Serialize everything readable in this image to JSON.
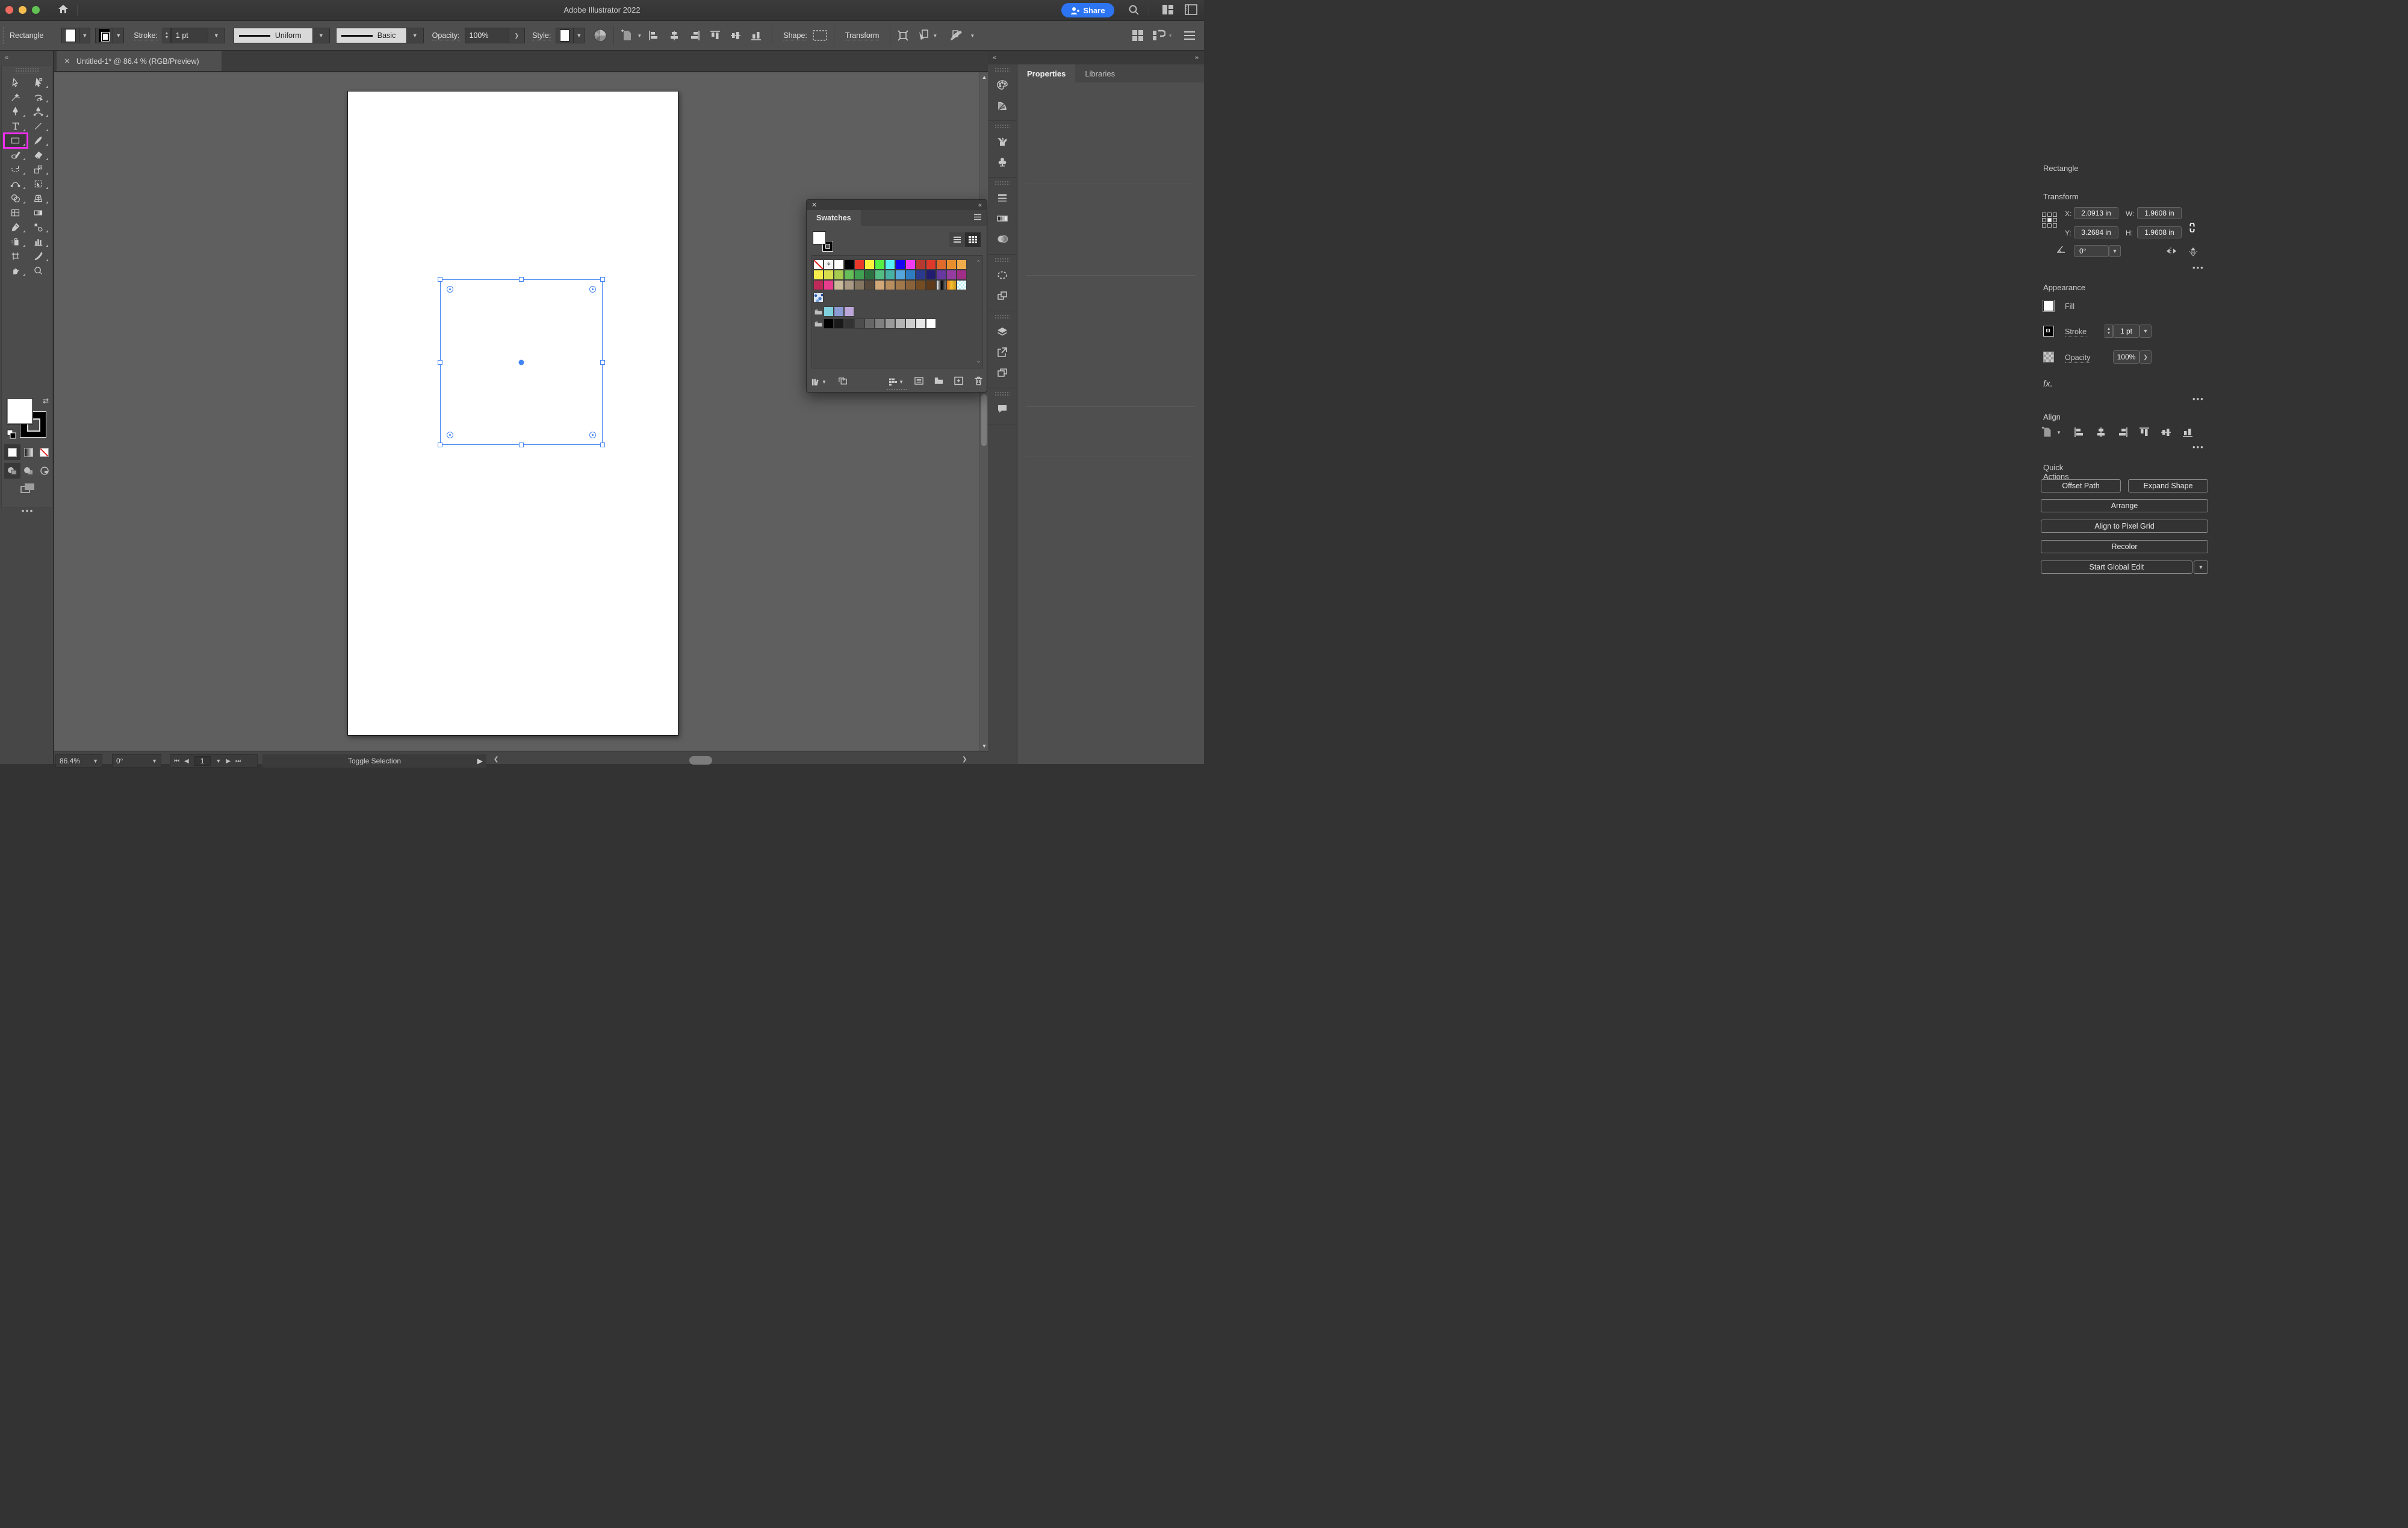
{
  "titlebar": {
    "title": "Adobe Illustrator 2022",
    "share_label": "Share"
  },
  "controlbar": {
    "selection_label": "Rectangle",
    "stroke_label": "Stroke:",
    "stroke_weight": "1 pt",
    "width_profile": "Uniform",
    "brush_definition": "Basic",
    "opacity_label": "Opacity:",
    "opacity_value": "100%",
    "style_label": "Style:",
    "shape_label": "Shape:",
    "transform_label": "Transform"
  },
  "tabbar": {
    "doc_title": "Untitled-1* @ 86.4 % (RGB/Preview)"
  },
  "tools": [
    {
      "name": "selection-tool",
      "flyout": false
    },
    {
      "name": "direct-selection-tool",
      "flyout": true
    },
    {
      "name": "magic-wand-tool",
      "flyout": false
    },
    {
      "name": "lasso-tool",
      "flyout": true
    },
    {
      "name": "pen-tool",
      "flyout": true
    },
    {
      "name": "curvature-tool",
      "flyout": true
    },
    {
      "name": "type-tool",
      "flyout": true
    },
    {
      "name": "line-segment-tool",
      "flyout": true
    },
    {
      "name": "rectangle-tool",
      "flyout": true,
      "active": true
    },
    {
      "name": "paintbrush-tool",
      "flyout": true
    },
    {
      "name": "shaper-tool",
      "flyout": true
    },
    {
      "name": "eraser-tool",
      "flyout": true
    },
    {
      "name": "rotate-tool",
      "flyout": true
    },
    {
      "name": "scale-tool",
      "flyout": true
    },
    {
      "name": "width-tool",
      "flyout": true
    },
    {
      "name": "free-transform-tool",
      "flyout": true
    },
    {
      "name": "shape-builder-tool",
      "flyout": true
    },
    {
      "name": "perspective-grid-tool",
      "flyout": true
    },
    {
      "name": "mesh-tool",
      "flyout": false
    },
    {
      "name": "gradient-tool",
      "flyout": false
    },
    {
      "name": "eyedropper-tool",
      "flyout": true
    },
    {
      "name": "blend-tool",
      "flyout": true
    },
    {
      "name": "symbol-sprayer-tool",
      "flyout": true
    },
    {
      "name": "column-graph-tool",
      "flyout": true
    },
    {
      "name": "artboard-tool",
      "flyout": false
    },
    {
      "name": "slice-tool",
      "flyout": true
    },
    {
      "name": "hand-tool",
      "flyout": true
    },
    {
      "name": "zoom-tool",
      "flyout": false
    }
  ],
  "swatches_panel": {
    "title": "Swatches",
    "rows": [
      [
        "none",
        "registration",
        "#FFFFFF",
        "#000000",
        "#E8392B",
        "#FCF23D",
        "#55EF46",
        "#57EFF5",
        "#1503F2",
        "#EF3BF2",
        "#B53831",
        "#DC392B",
        "#DE6A2C",
        "#E78F2E",
        "#EFAC4C"
      ],
      [
        "#F6EC4B",
        "#D9DF4C",
        "#A6CB4D",
        "#65BE57",
        "#3F9F53",
        "#2C6E40",
        "#53BE83",
        "#47B1A3",
        "#55A6DC",
        "#2E7DC3",
        "#2B3A8F",
        "#221C71",
        "#67389F",
        "#943C9F",
        "#A02E86"
      ],
      [
        "#BE2A58",
        "#E83C8C",
        "#C9B999",
        "#A99884",
        "#83755F",
        "#57493C",
        "#D2A878",
        "#B98E5F",
        "#A0784A",
        "#8A6239",
        "#744C24",
        "#5E3A1A",
        "gradient-bw",
        "gradient-orange",
        "checker"
      ]
    ],
    "pattern_row": [
      "pattern-blue"
    ],
    "color_groups": [
      [
        "#7FD0DC",
        "#8B9BD3",
        "#BCA7D8"
      ],
      [
        "#000000",
        "#1A1A1A",
        "#333333",
        "#4D4D4D",
        "#666666",
        "#808080",
        "#999999",
        "#B3B3B3",
        "#CCCCCC",
        "#E6E6E6",
        "#FFFFFF"
      ]
    ]
  },
  "right_strip_icons": [
    {
      "name": "color-panel-icon",
      "group": 0
    },
    {
      "name": "color-guide-panel-icon",
      "group": 0
    },
    {
      "name": "brushes-panel-icon",
      "group": 1
    },
    {
      "name": "symbols-panel-icon",
      "group": 1
    },
    {
      "name": "stroke-panel-icon",
      "group": 2
    },
    {
      "name": "gradient-panel-icon",
      "group": 2
    },
    {
      "name": "transparency-panel-icon",
      "group": 2
    },
    {
      "name": "appearance-panel-icon",
      "group": 3
    },
    {
      "name": "graphic-styles-panel-icon",
      "group": 3
    },
    {
      "name": "layers-panel-icon",
      "group": 4
    },
    {
      "name": "asset-export-panel-icon",
      "group": 4
    },
    {
      "name": "artboards-panel-icon",
      "group": 4
    },
    {
      "name": "comments-panel-icon",
      "group": 5
    }
  ],
  "properties_panel": {
    "tab_properties": "Properties",
    "tab_libraries": "Libraries",
    "object_type": "Rectangle",
    "transform": {
      "title": "Transform",
      "x_label": "X:",
      "x_value": "2.0913 in",
      "y_label": "Y:",
      "y_value": "3.2684 in",
      "w_label": "W:",
      "w_value": "1.9608 in",
      "h_label": "H:",
      "h_value": "1.9608 in",
      "angle_value": "0°"
    },
    "appearance": {
      "title": "Appearance",
      "fill_label": "Fill",
      "stroke_label": "Stroke",
      "stroke_weight": "1 pt",
      "opacity_label": "Opacity",
      "opacity_value": "100%",
      "fx_label": "fx."
    },
    "align": {
      "title": "Align"
    },
    "quick_actions": {
      "title": "Quick Actions",
      "buttons": [
        "Offset Path",
        "Expand Shape",
        "Arrange",
        "Align to Pixel Grid",
        "Recolor",
        "Start Global Edit"
      ]
    }
  },
  "statusbar": {
    "zoom": "86.4%",
    "rotation": "0°",
    "artboard_number": "1",
    "toggle_label": "Toggle Selection"
  }
}
